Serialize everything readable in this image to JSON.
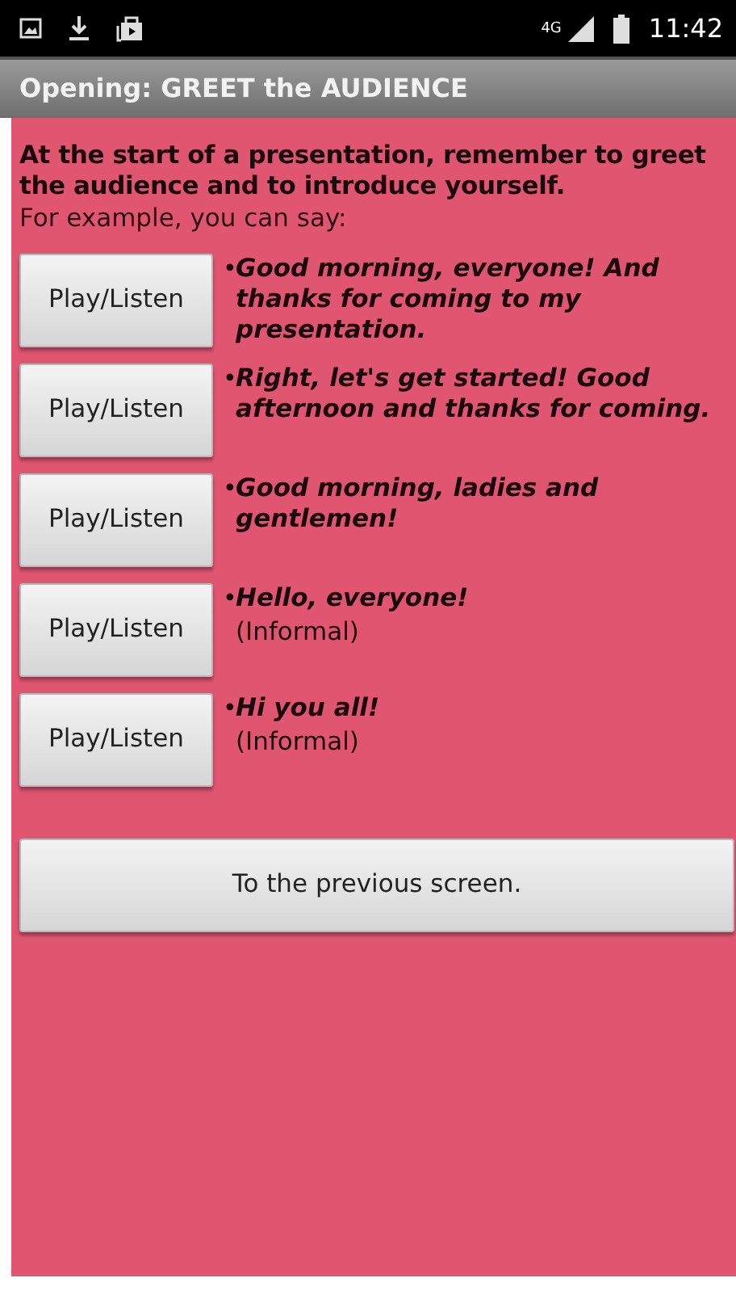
{
  "status_bar": {
    "network": "4G",
    "time": "11:42"
  },
  "title_bar": {
    "title": "Opening: GREET the AUDIENCE"
  },
  "intro": {
    "heading": "At the start of a presentation, remember to greet the audience and to introduce yourself.",
    "lead": "For example, you can say:"
  },
  "phrases": [
    {
      "button": "Play/Listen",
      "bullet": "•",
      "text": "Good morning, everyone! And thanks for coming to my presentation."
    },
    {
      "button": "Play/Listen",
      "bullet": "•",
      "text": "Right, let's get started! Good afternoon and thanks for coming."
    },
    {
      "button": "Play/Listen",
      "bullet": "•",
      "text": "Good morning, ladies and gentlemen!"
    },
    {
      "button": "Play/Listen",
      "bullet": "•",
      "text": "Hello, everyone!",
      "note": "(Informal)"
    },
    {
      "button": "Play/Listen",
      "bullet": "•",
      "text": "Hi you all!",
      "note": "(Informal)"
    }
  ],
  "back_button": "To the previous screen."
}
